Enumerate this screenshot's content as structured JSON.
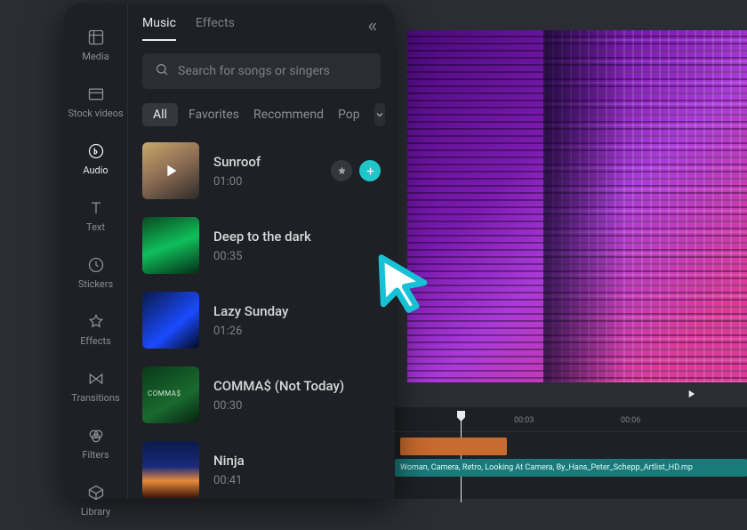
{
  "sidebar": {
    "items": [
      {
        "label": "Media"
      },
      {
        "label": "Stock videos"
      },
      {
        "label": "Audio"
      },
      {
        "label": "Text"
      },
      {
        "label": "Stickers"
      },
      {
        "label": "Effects"
      },
      {
        "label": "Transitions"
      },
      {
        "label": "Filters"
      },
      {
        "label": "Library"
      }
    ]
  },
  "panel": {
    "tabs": [
      {
        "label": "Music",
        "active": true
      },
      {
        "label": "Effects",
        "active": false
      }
    ],
    "search_placeholder": "Search for songs or singers",
    "chips": [
      "All",
      "Favorites",
      "Recommend",
      "Pop"
    ],
    "active_chip": "All"
  },
  "songs": [
    {
      "title": "Sunroof",
      "duration": "01:00",
      "selected": true
    },
    {
      "title": "Deep to the dark",
      "duration": "00:35",
      "selected": false
    },
    {
      "title": "Lazy Sunday",
      "duration": "01:26",
      "selected": false
    },
    {
      "title": "COMMA$ (Not Today)",
      "duration": "00:30",
      "selected": false
    },
    {
      "title": "Ninja",
      "duration": "00:41",
      "selected": false
    }
  ],
  "timeline": {
    "ticks": [
      "00:03",
      "00:06"
    ],
    "clip_label": "Woman, Camera, Retro, Looking At Camera, By_Hans_Peter_Schepp_Artlist_HD.mp"
  }
}
